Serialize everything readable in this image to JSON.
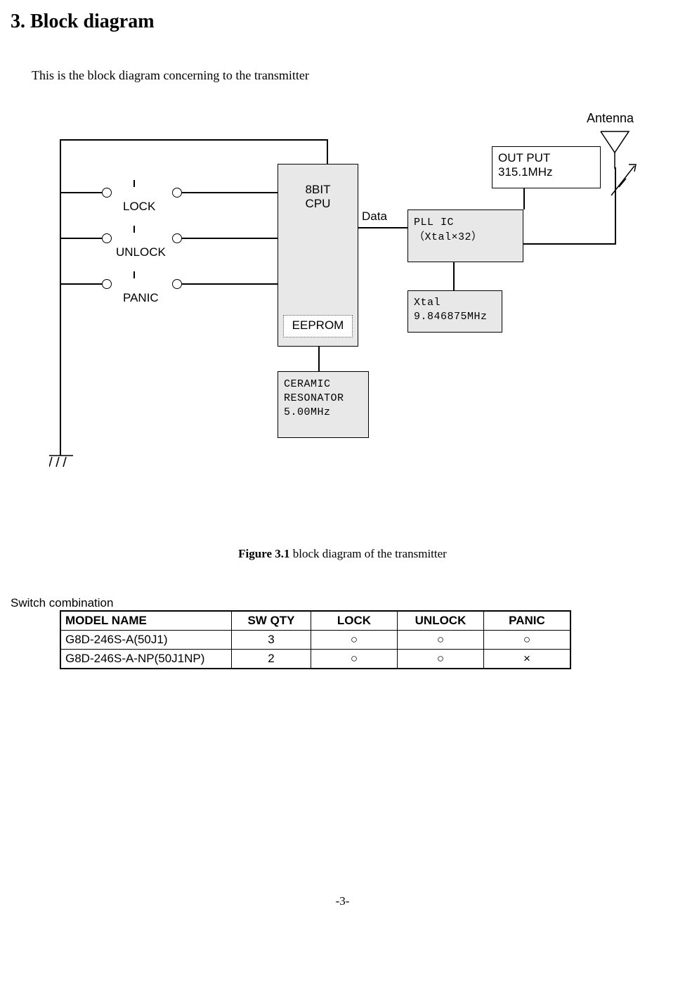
{
  "section": {
    "number": "3.",
    "title": "Block diagram"
  },
  "intro": "This is the block diagram concerning to the transmitter",
  "diagram": {
    "antenna_label": "Antenna",
    "switches": {
      "lock": "LOCK",
      "unlock": "UNLOCK",
      "panic": "PANIC"
    },
    "cpu": {
      "line1": "8BIT",
      "line2": "CPU",
      "eeprom": "EEPROM"
    },
    "data_label": "Data",
    "pll": {
      "line1": "PLL IC",
      "line2": "（Xtal×32）"
    },
    "xtal": {
      "line1": "Xtal",
      "line2": "9.846875MHz"
    },
    "output": {
      "line1": "OUT PUT",
      "line2": "315.1MHz"
    },
    "resonator": {
      "line1": "CERAMIC",
      "line2": "RESONATOR",
      "line3": "5.00MHz"
    }
  },
  "caption": {
    "bold": "Figure 3.1",
    "rest": " block diagram of the transmitter"
  },
  "table": {
    "title": "Switch combination",
    "headers": [
      "MODEL NAME",
      "SW QTY",
      "LOCK",
      "UNLOCK",
      "PANIC"
    ],
    "rows": [
      {
        "model": "G8D-246S-A(50J1)",
        "qty": "3",
        "lock": "○",
        "unlock": "○",
        "panic": "○"
      },
      {
        "model": "G8D-246S-A-NP(50J1NP)",
        "qty": "2",
        "lock": "○",
        "unlock": "○",
        "panic": "×"
      }
    ]
  },
  "page_number": "-3-",
  "chart_data": {
    "type": "table",
    "title": "Switch combination",
    "columns": [
      "MODEL NAME",
      "SW QTY",
      "LOCK",
      "UNLOCK",
      "PANIC"
    ],
    "data": [
      [
        "G8D-246S-A(50J1)",
        3,
        "○",
        "○",
        "○"
      ],
      [
        "G8D-246S-A-NP(50J1NP)",
        2,
        "○",
        "○",
        "×"
      ]
    ]
  }
}
